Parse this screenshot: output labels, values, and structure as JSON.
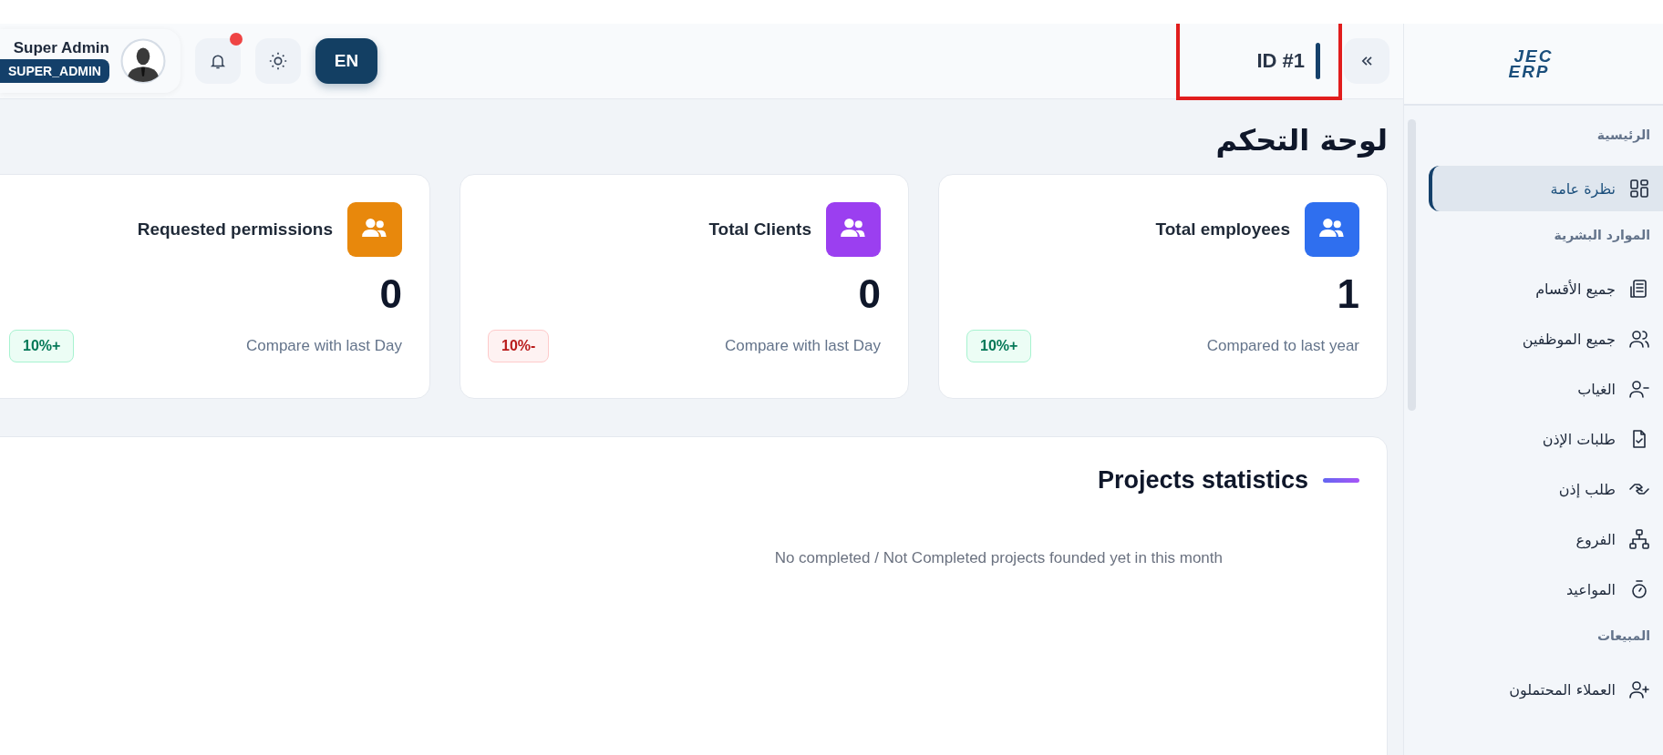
{
  "header": {
    "user": {
      "name": "Super Admin",
      "role": "SUPER_ADMIN"
    },
    "notifications": {
      "unread": true
    },
    "language": "EN",
    "id_label": "ID #1",
    "highlighted": true
  },
  "logo": {
    "line_1": "JEC",
    "line_2": "ERP"
  },
  "page_title": "لوحة التحكم",
  "stat_cards": [
    {
      "title": "Total employees",
      "value": "1",
      "caption": "Compared to last year",
      "change": "10%+",
      "kind": "positive",
      "color": "#2f6fef"
    },
    {
      "title": "Total Clients",
      "value": "0",
      "caption": "Compare with last Day",
      "change": "10%-",
      "kind": "negative",
      "color": "#9b3ff0"
    },
    {
      "title": "Requested permissions",
      "value": "0",
      "caption": "Compare with last Day",
      "change": "10%+",
      "kind": "positive",
      "color": "#e8880c"
    }
  ],
  "projects": {
    "title": "Projects statistics",
    "empty_message": "No completed / Not Completed projects founded yet in this month"
  },
  "sidebar": {
    "sections": [
      {
        "label": "الرئيسية",
        "items": [
          {
            "label": "نظرة عامة",
            "kind": "grid",
            "selected": true
          }
        ]
      },
      {
        "label": "الموارد البشرية",
        "items": [
          {
            "label": "جميع الأقسام",
            "kind": "building",
            "selected": false
          },
          {
            "label": "جميع الموظفين",
            "kind": "users",
            "selected": false
          },
          {
            "label": "الغياب",
            "kind": "user-minus",
            "selected": false
          },
          {
            "label": "طلبات الإذن",
            "kind": "file-check",
            "selected": false
          },
          {
            "label": "طلب إذن",
            "kind": "handshake",
            "selected": false
          },
          {
            "label": "الفروع",
            "kind": "hierarchy",
            "selected": false
          },
          {
            "label": "المواعيد",
            "kind": "timer",
            "selected": false
          }
        ]
      },
      {
        "label": "المبيعات",
        "items": [
          {
            "label": "العملاء المحتملون",
            "kind": "user-plus",
            "selected": false
          }
        ]
      }
    ]
  }
}
